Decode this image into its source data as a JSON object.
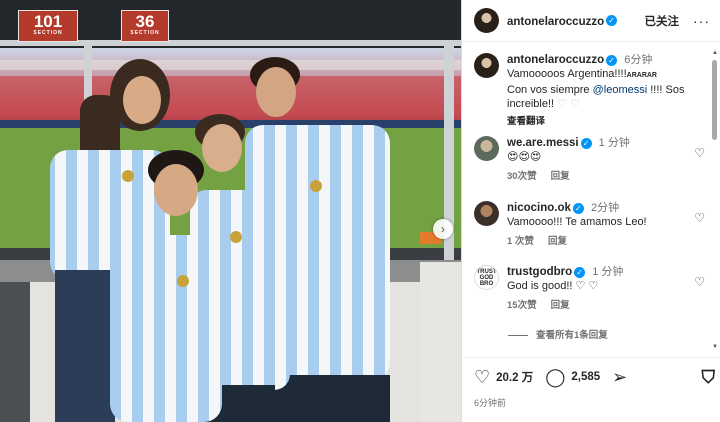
{
  "photo": {
    "section_left": {
      "number": "101",
      "label": "SECTION"
    },
    "section_right": {
      "number": "36",
      "label": "SECTION"
    },
    "next_icon": "chevron-right-icon"
  },
  "post": {
    "author": "antonelaroccuzzo",
    "follow_label": "已关注",
    "more_icon": "ellipsis-icon"
  },
  "caption": {
    "author": "antonelaroccuzzo",
    "time": "6分钟",
    "line1": "Vamooooos Argentina!!!!",
    "line1_tag": "ARARAR",
    "line2_pre": "Con vos siempre ",
    "mention": "@leomessi",
    "line2_post": " !!!! Sos increible!!",
    "hearts": "♡ ♡",
    "translate": "查看翻译"
  },
  "comments": [
    {
      "user": "we.are.messi",
      "time": "1 分钟",
      "text": "😍😍😍",
      "likes": "30次赞",
      "reply": "回复"
    },
    {
      "user": "nicocino.ok",
      "time": "2分钟",
      "text": "Vamoooo!!! Te amamos Leo!",
      "likes": "1 次赞",
      "reply": "回复"
    },
    {
      "user": "trustgodbro",
      "time": "1 分钟",
      "text": "God is good!! ♡ ♡",
      "likes": "15次赞",
      "reply": "回复",
      "avatar_text": "TRUST GOD BRO"
    }
  ],
  "view_replies": "查看所有1条回复",
  "actions": {
    "like_count": "20.2 万",
    "comment_count": "2,585",
    "time_ago": "6分钟前"
  }
}
